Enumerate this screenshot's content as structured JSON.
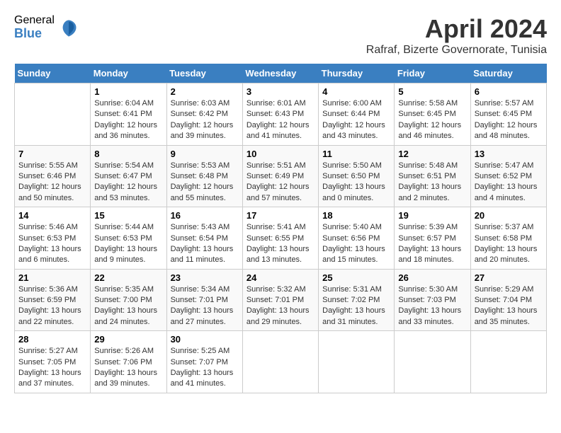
{
  "logo": {
    "general": "General",
    "blue": "Blue"
  },
  "title": "April 2024",
  "subtitle": "Rafraf, Bizerte Governorate, Tunisia",
  "days": [
    "Sunday",
    "Monday",
    "Tuesday",
    "Wednesday",
    "Thursday",
    "Friday",
    "Saturday"
  ],
  "weeks": [
    [
      {
        "num": "",
        "text": ""
      },
      {
        "num": "1",
        "text": "Sunrise: 6:04 AM\nSunset: 6:41 PM\nDaylight: 12 hours\nand 36 minutes."
      },
      {
        "num": "2",
        "text": "Sunrise: 6:03 AM\nSunset: 6:42 PM\nDaylight: 12 hours\nand 39 minutes."
      },
      {
        "num": "3",
        "text": "Sunrise: 6:01 AM\nSunset: 6:43 PM\nDaylight: 12 hours\nand 41 minutes."
      },
      {
        "num": "4",
        "text": "Sunrise: 6:00 AM\nSunset: 6:44 PM\nDaylight: 12 hours\nand 43 minutes."
      },
      {
        "num": "5",
        "text": "Sunrise: 5:58 AM\nSunset: 6:45 PM\nDaylight: 12 hours\nand 46 minutes."
      },
      {
        "num": "6",
        "text": "Sunrise: 5:57 AM\nSunset: 6:45 PM\nDaylight: 12 hours\nand 48 minutes."
      }
    ],
    [
      {
        "num": "7",
        "text": "Sunrise: 5:55 AM\nSunset: 6:46 PM\nDaylight: 12 hours\nand 50 minutes."
      },
      {
        "num": "8",
        "text": "Sunrise: 5:54 AM\nSunset: 6:47 PM\nDaylight: 12 hours\nand 53 minutes."
      },
      {
        "num": "9",
        "text": "Sunrise: 5:53 AM\nSunset: 6:48 PM\nDaylight: 12 hours\nand 55 minutes."
      },
      {
        "num": "10",
        "text": "Sunrise: 5:51 AM\nSunset: 6:49 PM\nDaylight: 12 hours\nand 57 minutes."
      },
      {
        "num": "11",
        "text": "Sunrise: 5:50 AM\nSunset: 6:50 PM\nDaylight: 13 hours\nand 0 minutes."
      },
      {
        "num": "12",
        "text": "Sunrise: 5:48 AM\nSunset: 6:51 PM\nDaylight: 13 hours\nand 2 minutes."
      },
      {
        "num": "13",
        "text": "Sunrise: 5:47 AM\nSunset: 6:52 PM\nDaylight: 13 hours\nand 4 minutes."
      }
    ],
    [
      {
        "num": "14",
        "text": "Sunrise: 5:46 AM\nSunset: 6:53 PM\nDaylight: 13 hours\nand 6 minutes."
      },
      {
        "num": "15",
        "text": "Sunrise: 5:44 AM\nSunset: 6:53 PM\nDaylight: 13 hours\nand 9 minutes."
      },
      {
        "num": "16",
        "text": "Sunrise: 5:43 AM\nSunset: 6:54 PM\nDaylight: 13 hours\nand 11 minutes."
      },
      {
        "num": "17",
        "text": "Sunrise: 5:41 AM\nSunset: 6:55 PM\nDaylight: 13 hours\nand 13 minutes."
      },
      {
        "num": "18",
        "text": "Sunrise: 5:40 AM\nSunset: 6:56 PM\nDaylight: 13 hours\nand 15 minutes."
      },
      {
        "num": "19",
        "text": "Sunrise: 5:39 AM\nSunset: 6:57 PM\nDaylight: 13 hours\nand 18 minutes."
      },
      {
        "num": "20",
        "text": "Sunrise: 5:37 AM\nSunset: 6:58 PM\nDaylight: 13 hours\nand 20 minutes."
      }
    ],
    [
      {
        "num": "21",
        "text": "Sunrise: 5:36 AM\nSunset: 6:59 PM\nDaylight: 13 hours\nand 22 minutes."
      },
      {
        "num": "22",
        "text": "Sunrise: 5:35 AM\nSunset: 7:00 PM\nDaylight: 13 hours\nand 24 minutes."
      },
      {
        "num": "23",
        "text": "Sunrise: 5:34 AM\nSunset: 7:01 PM\nDaylight: 13 hours\nand 27 minutes."
      },
      {
        "num": "24",
        "text": "Sunrise: 5:32 AM\nSunset: 7:01 PM\nDaylight: 13 hours\nand 29 minutes."
      },
      {
        "num": "25",
        "text": "Sunrise: 5:31 AM\nSunset: 7:02 PM\nDaylight: 13 hours\nand 31 minutes."
      },
      {
        "num": "26",
        "text": "Sunrise: 5:30 AM\nSunset: 7:03 PM\nDaylight: 13 hours\nand 33 minutes."
      },
      {
        "num": "27",
        "text": "Sunrise: 5:29 AM\nSunset: 7:04 PM\nDaylight: 13 hours\nand 35 minutes."
      }
    ],
    [
      {
        "num": "28",
        "text": "Sunrise: 5:27 AM\nSunset: 7:05 PM\nDaylight: 13 hours\nand 37 minutes."
      },
      {
        "num": "29",
        "text": "Sunrise: 5:26 AM\nSunset: 7:06 PM\nDaylight: 13 hours\nand 39 minutes."
      },
      {
        "num": "30",
        "text": "Sunrise: 5:25 AM\nSunset: 7:07 PM\nDaylight: 13 hours\nand 41 minutes."
      },
      {
        "num": "",
        "text": ""
      },
      {
        "num": "",
        "text": ""
      },
      {
        "num": "",
        "text": ""
      },
      {
        "num": "",
        "text": ""
      }
    ]
  ]
}
